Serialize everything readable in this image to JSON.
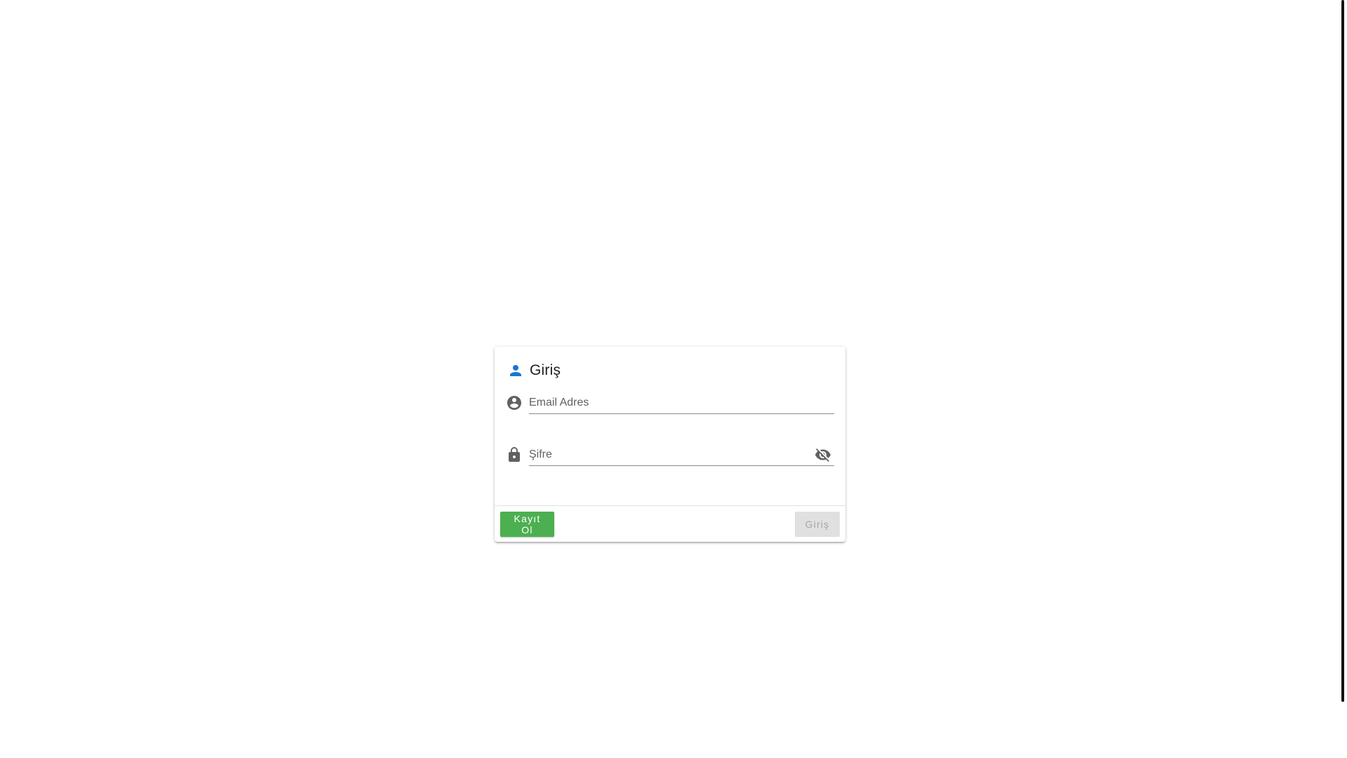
{
  "login_card": {
    "title": "Giriş",
    "title_icon": "person-icon",
    "email_field": {
      "icon": "account-circle-icon",
      "placeholder": "Email Adres",
      "value": ""
    },
    "password_field": {
      "icon": "lock-icon",
      "placeholder": "Şifre",
      "value": "",
      "visibility_icon": "visibility-off-icon"
    },
    "actions": {
      "register_label": "Kayıt Ol",
      "login_label": "Giriş",
      "login_disabled": true
    }
  },
  "colors": {
    "accent": "#1976d2",
    "register_button": "#4caf50",
    "disabled_button": "#e0e0e0",
    "icon_gray": "#616161"
  }
}
